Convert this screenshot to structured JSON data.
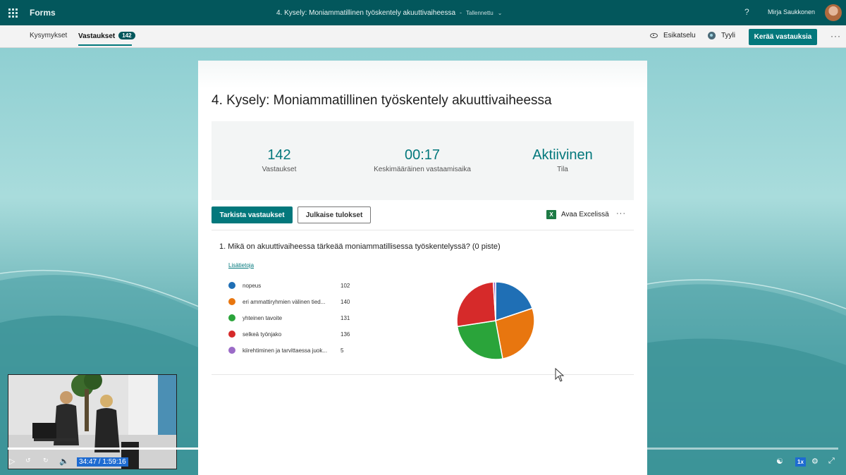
{
  "app": {
    "brand": "Forms",
    "doc_title": "4. Kysely: Moniammatillinen työskentely akuuttivaiheessa",
    "separator": "-",
    "save_status": "Tallennettu",
    "help": "?",
    "user_name": "Mirja Saukkonen"
  },
  "nav": {
    "tab_questions": "Kysymykset",
    "tab_responses": "Vastaukset",
    "responses_badge": "142",
    "preview": "Esikatselu",
    "style": "Tyyli",
    "collect": "Kerää vastauksia",
    "more": "···"
  },
  "card": {
    "title": "4. Kysely: Moniammatillinen työskentely akuuttivaiheessa",
    "stats": [
      {
        "value": "142",
        "label": "Vastaukset"
      },
      {
        "value": "00:17",
        "label": "Keskimääräinen vastaamisaika"
      },
      {
        "value": "Aktiivinen",
        "label": "Tila"
      }
    ],
    "review_button": "Tarkista vastaukset",
    "publish_button": "Julkaise tulokset",
    "excel_label": "Avaa Excelissä",
    "more": "···",
    "question": "1.  Mikä on akuuttivaiheessa tärkeää moniammatillisessa työskentelyssä? (0 piste)",
    "more_details": "Lisätietoja"
  },
  "chart_data": {
    "type": "pie",
    "categories": [
      "nopeus",
      "eri ammattiryhmien välinen tied...",
      "yhteinen tavoite",
      "selkeä työnjako",
      "kiirehtiminen ja tarvittaessa juok..."
    ],
    "values": [
      102,
      140,
      131,
      136,
      5
    ],
    "colors": [
      "#1f6fb5",
      "#e8760f",
      "#2aa43a",
      "#d62a2a",
      "#9b6bc7"
    ],
    "legend_position": "left"
  },
  "video": {
    "time": "34:47 / 1:59:16",
    "speed": "1x",
    "progress": 0.291
  }
}
